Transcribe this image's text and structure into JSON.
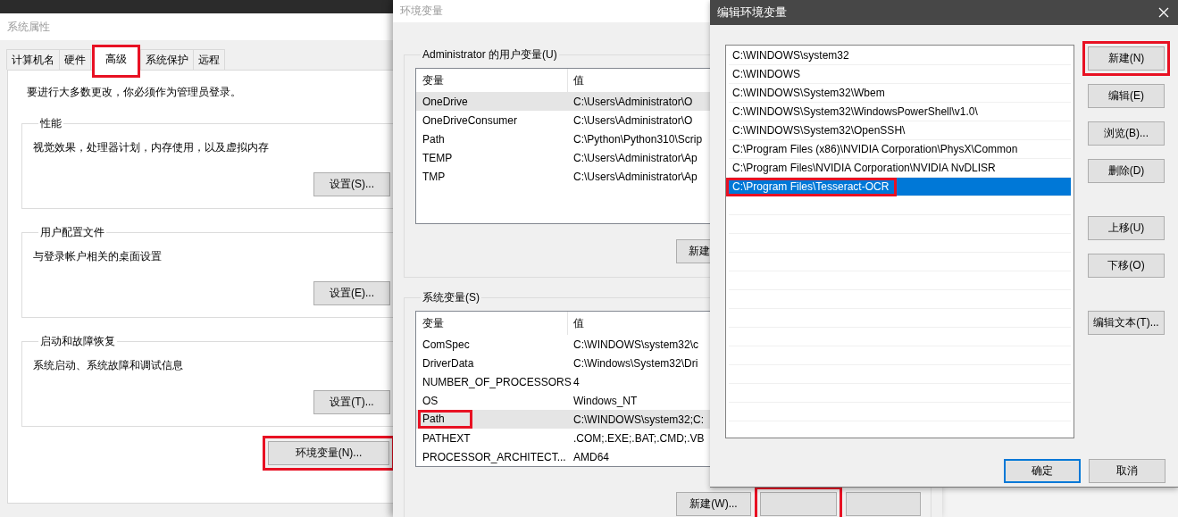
{
  "system_properties": {
    "title": "系统属性",
    "tabs": [
      {
        "label": "计算机名",
        "selected": false,
        "highlighted": false
      },
      {
        "label": "硬件",
        "selected": false,
        "highlighted": false
      },
      {
        "label": "高级",
        "selected": true,
        "highlighted": true
      },
      {
        "label": "系统保护",
        "selected": false,
        "highlighted": false
      },
      {
        "label": "远程",
        "selected": false,
        "highlighted": false
      }
    ],
    "notice": "要进行大多数更改，你必须作为管理员登录。",
    "groups": [
      {
        "title": "性能",
        "description": "视觉效果，处理器计划，内存使用，以及虚拟内存",
        "button": "设置(S)..."
      },
      {
        "title": "用户配置文件",
        "description": "与登录帐户相关的桌面设置",
        "button": "设置(E)..."
      },
      {
        "title": "启动和故障恢复",
        "description": "系统启动、系统故障和调试信息",
        "button": "设置(T)..."
      }
    ],
    "env_button": {
      "label": "环境变量(N)...",
      "highlighted": true
    }
  },
  "environment_variables": {
    "title": "环境变量",
    "user_group": {
      "title": "Administrator 的用户变量(U)",
      "columns": [
        "变量",
        "值"
      ],
      "rows": [
        {
          "name": "OneDrive",
          "value": "C:\\Users\\Administrator\\O",
          "selected": true,
          "highlighted": false
        },
        {
          "name": "OneDriveConsumer",
          "value": "C:\\Users\\Administrator\\O",
          "selected": false,
          "highlighted": false
        },
        {
          "name": "Path",
          "value": "C:\\Python\\Python310\\Scrip",
          "selected": false,
          "highlighted": false
        },
        {
          "name": "TEMP",
          "value": "C:\\Users\\Administrator\\Ap",
          "selected": false,
          "highlighted": false
        },
        {
          "name": "TMP",
          "value": "C:\\Users\\Administrator\\Ap",
          "selected": false,
          "highlighted": false
        }
      ],
      "buttons": [
        {
          "label": "新建",
          "highlighted": false
        }
      ]
    },
    "system_group": {
      "title": "系统变量(S)",
      "columns": [
        "变量",
        "值"
      ],
      "rows": [
        {
          "name": "ComSpec",
          "value": "C:\\WINDOWS\\system32\\c",
          "selected": false,
          "highlighted": false
        },
        {
          "name": "DriverData",
          "value": "C:\\Windows\\System32\\Dri",
          "selected": false,
          "highlighted": false
        },
        {
          "name": "NUMBER_OF_PROCESSORS",
          "value": "4",
          "selected": false,
          "highlighted": false
        },
        {
          "name": "OS",
          "value": "Windows_NT",
          "selected": false,
          "highlighted": false
        },
        {
          "name": "Path",
          "value": "C:\\WINDOWS\\system32;C:",
          "selected": true,
          "highlighted": true
        },
        {
          "name": "PATHEXT",
          "value": ".COM;.EXE;.BAT;.CMD;.VB",
          "selected": false,
          "highlighted": false
        },
        {
          "name": "PROCESSOR_ARCHITECT...",
          "value": "AMD64",
          "selected": false,
          "highlighted": false
        }
      ],
      "buttons": [
        {
          "label": "新建(W)...",
          "highlighted": false
        },
        {
          "highlighted": true
        },
        {
          "highlighted": false
        }
      ]
    }
  },
  "edit_dialog": {
    "title": "编辑环境变量",
    "entries": [
      {
        "text": "C:\\WINDOWS\\system32",
        "selected": false,
        "highlighted": false
      },
      {
        "text": "C:\\WINDOWS",
        "selected": false,
        "highlighted": false
      },
      {
        "text": "C:\\WINDOWS\\System32\\Wbem",
        "selected": false,
        "highlighted": false
      },
      {
        "text": "C:\\WINDOWS\\System32\\WindowsPowerShell\\v1.0\\",
        "selected": false,
        "highlighted": false
      },
      {
        "text": "C:\\WINDOWS\\System32\\OpenSSH\\",
        "selected": false,
        "highlighted": false
      },
      {
        "text": "C:\\Program Files (x86)\\NVIDIA Corporation\\PhysX\\Common",
        "selected": false,
        "highlighted": false
      },
      {
        "text": "C:\\Program Files\\NVIDIA Corporation\\NVIDIA NvDLISR",
        "selected": false,
        "highlighted": false
      },
      {
        "text": "C:\\Program Files\\Tesseract-OCR",
        "selected": true,
        "highlighted": true
      }
    ],
    "side_button_groups": [
      [
        {
          "label": "新建(N)",
          "highlighted": true
        },
        {
          "label": "编辑(E)",
          "highlighted": false
        },
        {
          "label": "浏览(B)...",
          "highlighted": false
        },
        {
          "label": "删除(D)",
          "highlighted": false
        }
      ],
      [
        {
          "label": "上移(U)",
          "highlighted": false
        },
        {
          "label": "下移(O)",
          "highlighted": false
        }
      ],
      [
        {
          "label": "编辑文本(T)...",
          "highlighted": false
        }
      ]
    ],
    "footer_buttons": [
      {
        "label": "确定",
        "default": true
      },
      {
        "label": "取消",
        "default": false
      }
    ]
  }
}
